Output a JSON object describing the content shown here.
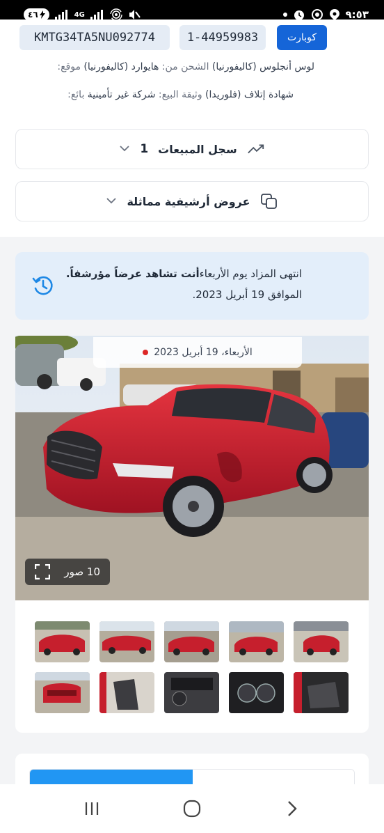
{
  "status_bar": {
    "time": "٩:٥٣",
    "battery": "٤٦",
    "network": "4G"
  },
  "vehicle": {
    "vin": "KMTG34TA5NU092774",
    "lot_number": "1-44959983",
    "seller_site": "كوبارت"
  },
  "info": {
    "location_label": "موقع:",
    "location_value": "لوس أنجلوس (كاليفورنيا)",
    "shipping_label": "الشحن من:",
    "shipping_value": "هايوارد (كاليفورنيا)",
    "doc_label": "وثيقة البيع:",
    "doc_value": "شهادة إتلاف (فلوريدا)",
    "seller_label": "بائع:",
    "seller_value": "شركة غير تأمينية"
  },
  "accordions": {
    "sales_history_title": "سجل المبيعات",
    "sales_history_count": "1",
    "similar_archive_title": "عروض أرشيفية مماثلة"
  },
  "notice": {
    "text_part1": "انتهى المزاد يوم الأربعاء",
    "text_part2": "أنت تشاهد عرضاً مؤرشفاً.",
    "text_part3": "الموافق 19 أبريل 2023."
  },
  "gallery": {
    "date": "الأربعاء، 19 أبريل 2023",
    "photo_count": "10 صور",
    "thumbnails": [
      "front-left view",
      "left side view",
      "right side view",
      "rear-right view",
      "front view",
      "rear view",
      "front seats",
      "dashboard",
      "instrument cluster",
      "interior seats"
    ]
  },
  "colors": {
    "accent": "#1565d8",
    "notice_bg": "#e3eefa",
    "car_red": "#c0192a",
    "tab_active": "#2196f3"
  }
}
